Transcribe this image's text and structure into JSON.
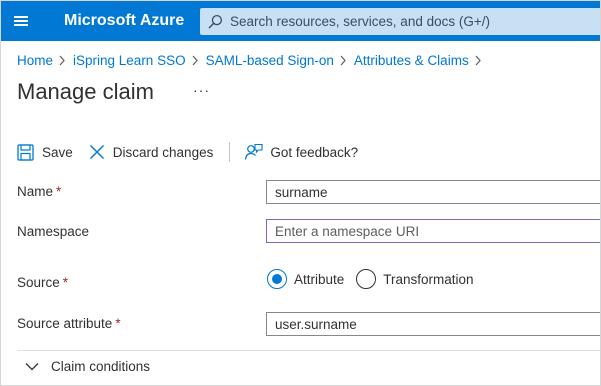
{
  "header": {
    "menu_icon": "hamburger-icon",
    "brand": "Microsoft Azure",
    "search_placeholder": "Search resources, services, and docs (G+/)",
    "search_icon": "search-icon"
  },
  "breadcrumb": {
    "items": [
      "Home",
      "iSpring Learn SSO",
      "SAML-based Sign-on",
      "Attributes & Claims"
    ],
    "separator_icon": "chevron-right-icon"
  },
  "page": {
    "title": "Manage claim",
    "more_label": "···"
  },
  "toolbar": {
    "save_label": "Save",
    "discard_label": "Discard changes",
    "feedback_label": "Got feedback?"
  },
  "form": {
    "name": {
      "label": "Name",
      "required": "*",
      "value": "surname"
    },
    "namespace": {
      "label": "Namespace",
      "placeholder": "Enter a namespace URI",
      "value": ""
    },
    "source": {
      "label": "Source",
      "required": "*",
      "options": [
        "Attribute",
        "Transformation"
      ],
      "selected": "Attribute"
    },
    "source_attribute": {
      "label": "Source attribute",
      "required": "*",
      "value": "user.surname"
    },
    "claim_conditions": {
      "label": "Claim conditions",
      "icon": "chevron-down-icon"
    }
  },
  "colors": {
    "brand_blue": "#0078d4",
    "search_bg": "#c7e0f4",
    "required_red": "#a4262c",
    "focus_purple": "#8764b8"
  }
}
